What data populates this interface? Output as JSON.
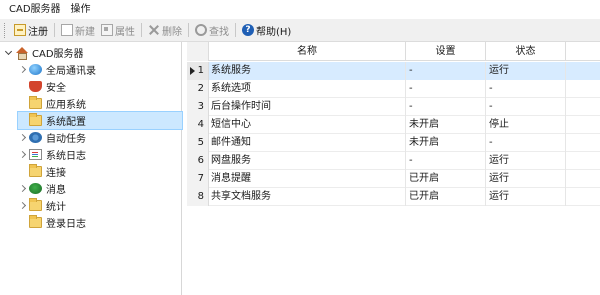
{
  "menu": {
    "items": [
      "CAD服务器",
      "操作"
    ]
  },
  "toolbar": {
    "register": "注册",
    "new": "新建",
    "properties": "属性",
    "delete": "删除",
    "find": "查找",
    "help": "帮助(H)"
  },
  "tree": {
    "root": "CAD服务器",
    "items": [
      {
        "label": "全局通讯录",
        "expandable": true,
        "icon": "globe-icon"
      },
      {
        "label": "安全",
        "expandable": false,
        "icon": "shield-icon"
      },
      {
        "label": "应用系统",
        "expandable": false,
        "icon": "folder-icon"
      },
      {
        "label": "系统配置",
        "expandable": false,
        "icon": "folder-icon",
        "selected": true
      },
      {
        "label": "自动任务",
        "expandable": true,
        "icon": "gears-icon"
      },
      {
        "label": "系统日志",
        "expandable": true,
        "icon": "log-icon"
      },
      {
        "label": "连接",
        "expandable": false,
        "icon": "folder-icon"
      },
      {
        "label": "消息",
        "expandable": true,
        "icon": "message-icon"
      },
      {
        "label": "统计",
        "expandable": true,
        "icon": "folder-icon"
      },
      {
        "label": "登录日志",
        "expandable": false,
        "icon": "folder-icon"
      }
    ]
  },
  "grid": {
    "columns": [
      "名称",
      "设置",
      "状态"
    ],
    "rows": [
      {
        "num": "1",
        "name": "系统服务",
        "setting": "-",
        "status": "运行"
      },
      {
        "num": "2",
        "name": "系统选项",
        "setting": "-",
        "status": "-"
      },
      {
        "num": "3",
        "name": "后台操作时间",
        "setting": "-",
        "status": "-"
      },
      {
        "num": "4",
        "name": "短信中心",
        "setting": "未开启",
        "status": "停止"
      },
      {
        "num": "5",
        "name": "邮件通知",
        "setting": "未开启",
        "status": "-"
      },
      {
        "num": "6",
        "name": "网盘服务",
        "setting": "-",
        "status": "运行"
      },
      {
        "num": "7",
        "name": "消息提醒",
        "setting": "已开启",
        "status": "运行"
      },
      {
        "num": "8",
        "name": "共享文档服务",
        "setting": "已开启",
        "status": "运行"
      }
    ]
  }
}
